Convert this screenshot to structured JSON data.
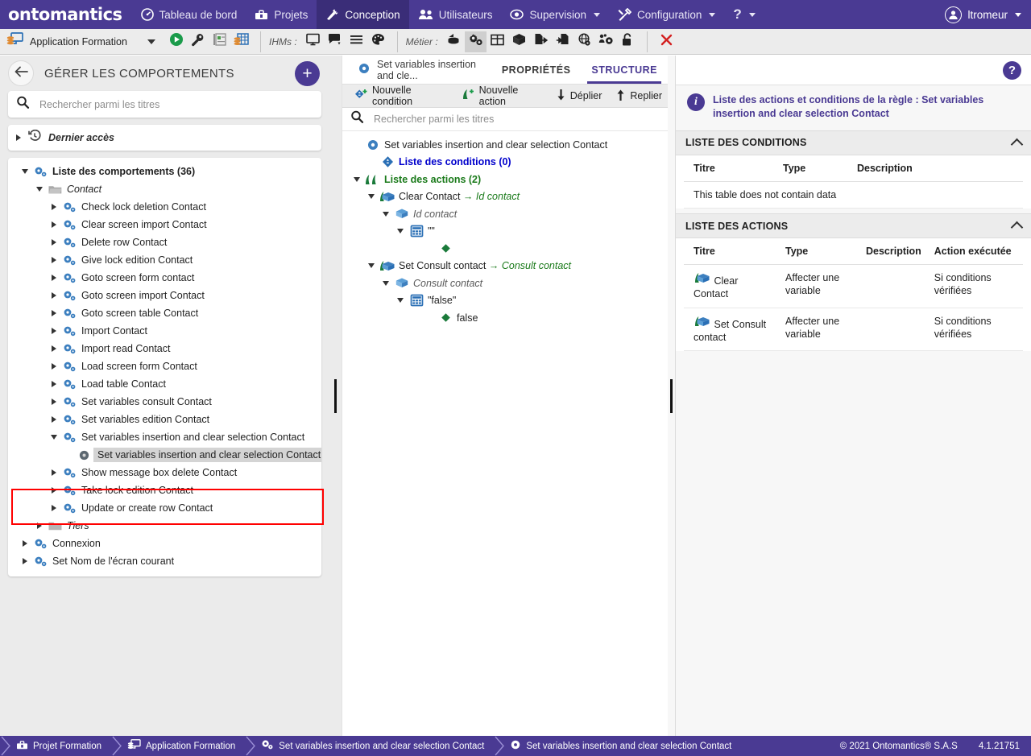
{
  "topnav": {
    "brand": "ontomantics",
    "items": [
      {
        "label": "Tableau de bord",
        "icon": "dashboard-icon",
        "active": false,
        "caret": false
      },
      {
        "label": "Projets",
        "icon": "toolbox-icon",
        "active": false,
        "caret": false
      },
      {
        "label": "Conception",
        "icon": "design-tools-icon",
        "active": true,
        "caret": false
      },
      {
        "label": "Utilisateurs",
        "icon": "users-icon",
        "active": false,
        "caret": false
      },
      {
        "label": "Supervision",
        "icon": "eye-icon",
        "active": false,
        "caret": true
      },
      {
        "label": "Configuration",
        "icon": "wrench-screwdriver-icon",
        "active": false,
        "caret": true
      },
      {
        "label": "?",
        "icon": "help-icon",
        "active": false,
        "caret": true
      }
    ],
    "user": "ltromeur"
  },
  "toolbar": {
    "app_name": "Application Formation",
    "run_icon": "play-icon",
    "wrench_icon": "wrench-icon",
    "doc_icon": "document-list-icon",
    "db_icon": "database-table-icon",
    "ihm_label": "IHMs :",
    "ihm_icons": [
      "screen-icon",
      "message-bubble-icon",
      "menu-lines-icon",
      "palette-icon"
    ],
    "metier_label": "Métier :",
    "metier_icons": [
      "data-stack-icon",
      "gears-icon",
      "table-grid-icon",
      "cube-icon",
      "export-icon",
      "import-icon",
      "webservice-icon",
      "roles-icon",
      "unlock-icon"
    ],
    "close_icon": "close-x-icon"
  },
  "left": {
    "title": "GÉRER LES COMPORTEMENTS",
    "back_icon": "arrow-left-icon",
    "add_label": "+",
    "search_placeholder": "Rechercher parmi les titres",
    "search_value": "",
    "recent_label": "Dernier accès",
    "root_label": "Liste des comportements (36)",
    "folder_contact": "Contact",
    "behaviors": [
      "Check lock deletion Contact",
      "Clear screen import Contact",
      "Delete row Contact",
      "Give lock edition Contact",
      "Goto screen form contact",
      "Goto screen import Contact",
      "Goto screen table Contact",
      "Import Contact",
      "Import read Contact",
      "Load screen form Contact",
      "Load table Contact",
      "Set variables consult Contact",
      "Set variables edition Contact"
    ],
    "selected_parent": "Set variables insertion and clear selection Contact",
    "selected_child": "Set variables insertion and clear selection Contact",
    "behaviors_after": [
      "Show message box delete Contact",
      "Take lock edition Contact",
      "Update or create row Contact"
    ],
    "folder_tiers": "Tiers",
    "root_connexion": "Connexion",
    "root_screenname": "Set Nom de l'écran courant"
  },
  "center": {
    "tabs": [
      {
        "label": "Set variables insertion and cle...",
        "icon": "gear-icon",
        "active": false,
        "upper": false
      },
      {
        "label": "PROPRIÉTÉS",
        "icon": "",
        "active": false,
        "upper": true
      },
      {
        "label": "STRUCTURE",
        "icon": "",
        "active": true,
        "upper": true
      }
    ],
    "actions": [
      {
        "label": "Nouvelle condition",
        "icon": "new-condition-icon"
      },
      {
        "label": "Nouvelle action",
        "icon": "new-action-icon"
      },
      {
        "label": "Déplier",
        "icon": "expand-all-icon"
      },
      {
        "label": "Replier",
        "icon": "collapse-all-icon"
      }
    ],
    "search_placeholder": "Rechercher parmi les titres",
    "search_value": "",
    "tree": {
      "root": "Set variables insertion and clear selection Contact",
      "conditions": "Liste des conditions (0)",
      "actions": "Liste des actions (2)",
      "action1": {
        "name": "Clear Contact",
        "arrow": "→",
        "target": "Id contact"
      },
      "action1_var": "Id contact",
      "action1_value": "\"\"",
      "action1_leaf": "",
      "action2": {
        "name": "Set Consult contact",
        "arrow": "→",
        "target": "Consult contact"
      },
      "action2_var": "Consult contact",
      "action2_value": "\"false\"",
      "action2_leaf": "false"
    }
  },
  "right": {
    "help_label": "?",
    "info_label": "i",
    "info_text": "Liste des actions et conditions de la règle : Set variables insertion and clear selection Contact",
    "conditions": {
      "title": "LISTE DES CONDITIONS",
      "headers": [
        "Titre",
        "Type",
        "Description"
      ],
      "empty_text": "This table does not contain data",
      "rows": []
    },
    "actions": {
      "title": "LISTE DES ACTIONS",
      "headers": [
        "Titre",
        "Type",
        "Description",
        "Action exécutée"
      ],
      "rows": [
        {
          "titre": "Clear Contact",
          "type": "Affecter une variable",
          "description": "",
          "executee": "Si conditions vérifiées"
        },
        {
          "titre": "Set Consult contact",
          "type": "Affecter une variable",
          "description": "",
          "executee": "Si conditions vérifiées"
        }
      ]
    }
  },
  "status": {
    "crumbs": [
      {
        "label": "Projet Formation",
        "icon": "toolbox-icon"
      },
      {
        "label": "Application Formation",
        "icon": "app-icon"
      },
      {
        "label": "Set variables insertion and clear selection Contact",
        "icon": "gears-icon"
      },
      {
        "label": "Set variables insertion and clear selection Contact",
        "icon": "gear-icon"
      }
    ],
    "copyright": "© 2021 Ontomantics® S.A.S",
    "version": "4.1.21751"
  },
  "colors": {
    "brand_purple": "#4a3a93",
    "active_nav": "#3a2d78",
    "highlight_red": "#ff0000",
    "tree_blue": "#0000cc",
    "tree_green": "#1a7a1a"
  }
}
